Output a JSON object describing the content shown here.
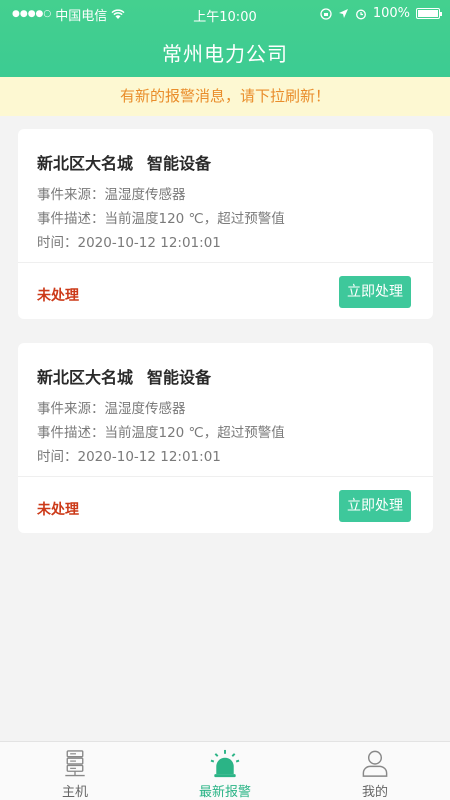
{
  "statusbar": {
    "carrier": "中国电信",
    "time": "上午10:00",
    "battery": "100%"
  },
  "header": {
    "title": "常州电力公司"
  },
  "notice": "有新的报警消息，请下拉刷新！",
  "cards": [
    {
      "location": "新北区大名城",
      "device": "智能设备",
      "source": "事件来源：温湿度传感器",
      "desc": "事件描述：当前温度120 ℃，超过预警值",
      "time": "时间：2020-10-12 12:01:01",
      "status": "未处理",
      "action": "立即处理"
    },
    {
      "location": "新北区大名城",
      "device": "智能设备",
      "source": "事件来源：温湿度传感器",
      "desc": "事件描述：当前温度120 ℃，超过预警值",
      "time": "时间：2020-10-12 12:01:01",
      "status": "未处理",
      "action": "立即处理"
    }
  ],
  "tabs": [
    {
      "label": "主机",
      "icon": "server-icon"
    },
    {
      "label": "最新报警",
      "icon": "alarm-light-icon",
      "active": true
    },
    {
      "label": "我的",
      "icon": "user-icon"
    }
  ],
  "colors": {
    "header": "#3ccb92",
    "accent": "#3ec89b",
    "warning": "#cc3a19",
    "notice_bg": "#fdf8d2",
    "notice_text": "#e98d2b"
  }
}
